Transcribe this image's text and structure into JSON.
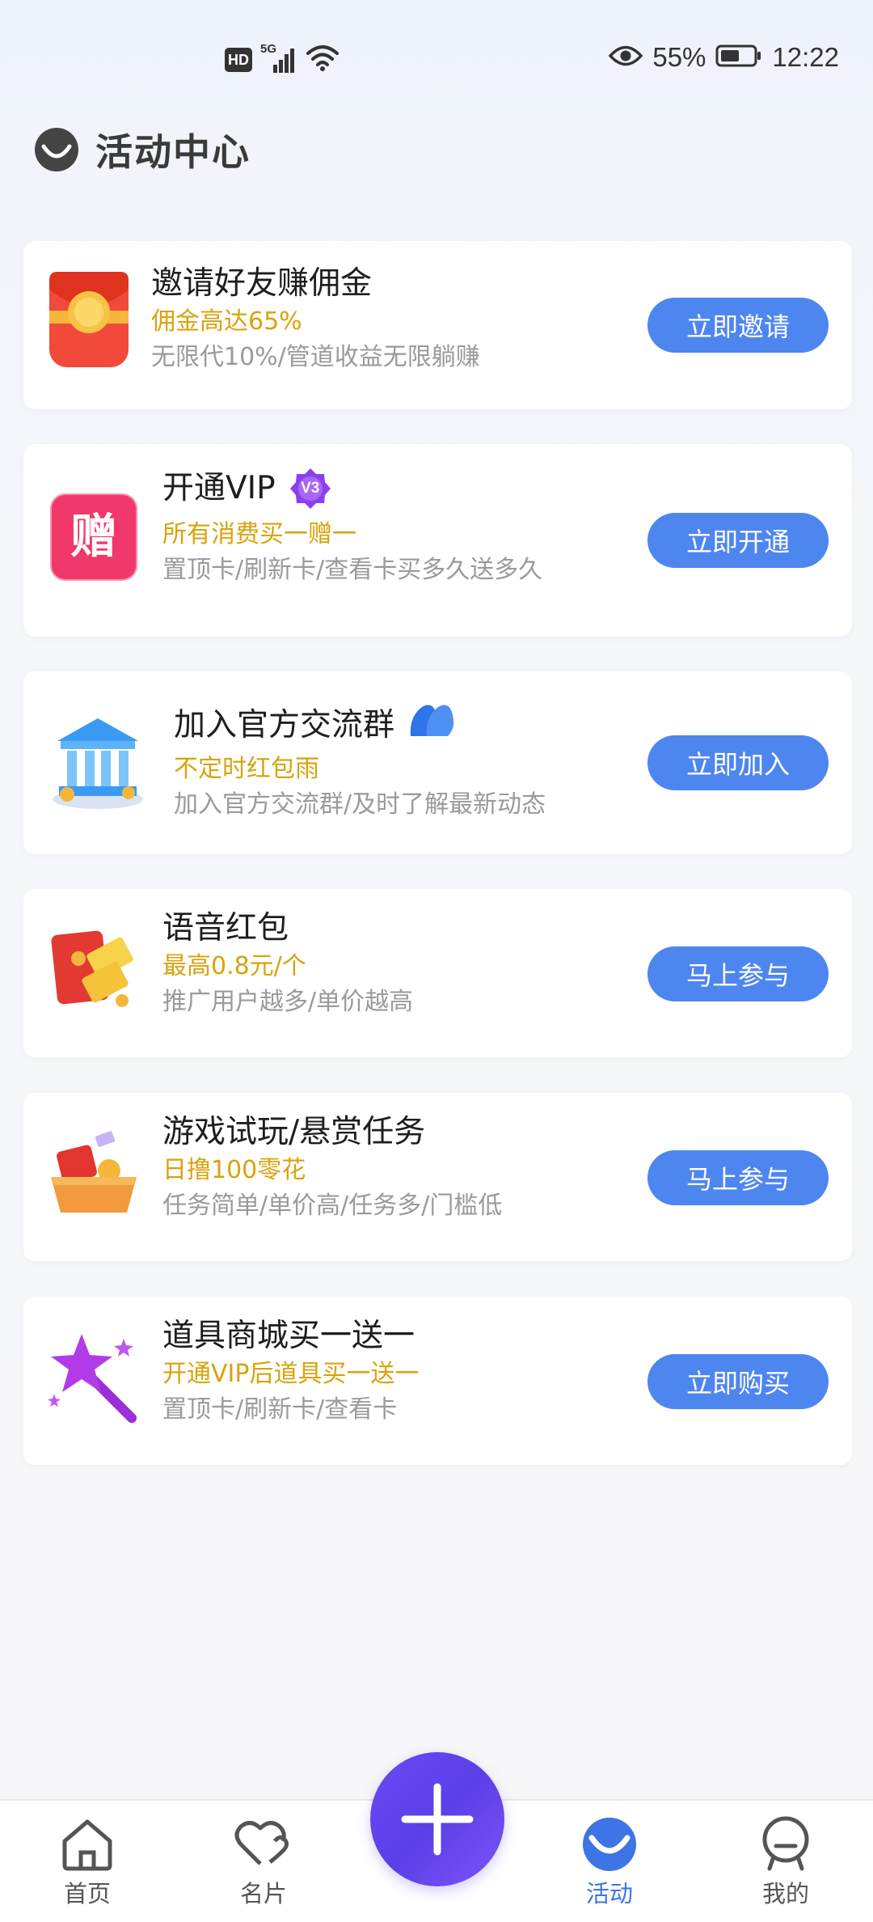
{
  "status_bar": {
    "left_badge": "HD",
    "network": "5G",
    "battery": "55%",
    "time": "12:22"
  },
  "header": {
    "title": "活动中心"
  },
  "cards": [
    {
      "title": "邀请好友赚佣金",
      "highlight": "佣金高达65%",
      "desc": "无限代10%/管道收益无限躺赚",
      "button": "立即邀请",
      "icon": "red-envelope-icon"
    },
    {
      "title": "开通VIP",
      "highlight": "所有消费买一赠一",
      "desc": "置顶卡/刷新卡/查看卡买多久送多久",
      "button": "立即开通",
      "icon": "gift-badge-icon",
      "badge": "V3",
      "icon_text": "赠"
    },
    {
      "title": "加入官方交流群",
      "highlight": "不定时红包雨",
      "desc": "加入官方交流群/及时了解最新动态",
      "button": "立即加入",
      "icon": "bank-building-icon"
    },
    {
      "title": "语音红包",
      "highlight": "最高0.8元/个",
      "desc": "推广用户越多/单价越高",
      "button": "马上参与",
      "icon": "red-packet-coupon-icon"
    },
    {
      "title": "游戏试玩/悬赏任务",
      "highlight": "日撸100零花",
      "desc": "任务简单/单价高/任务多/门槛低",
      "button": "马上参与",
      "icon": "reward-basket-icon"
    },
    {
      "title": "道具商城买一送一",
      "highlight": "开通VIP后道具买一送一",
      "desc": "置顶卡/刷新卡/查看卡",
      "button": "立即购买",
      "icon": "magic-wand-icon"
    }
  ],
  "bottom_nav": {
    "items": [
      {
        "label": "首页",
        "icon": "home-icon",
        "active": false
      },
      {
        "label": "名片",
        "icon": "heart-card-icon",
        "active": false
      },
      {
        "label": "活动",
        "icon": "activity-icon",
        "active": true
      },
      {
        "label": "我的",
        "icon": "profile-icon",
        "active": false
      }
    ],
    "fab_icon": "plus-icon"
  },
  "colors": {
    "accent": "#4e86f0",
    "highlight_text": "#d8a30c",
    "nav_active": "#3f74e6",
    "fab": "#6a4af5"
  }
}
